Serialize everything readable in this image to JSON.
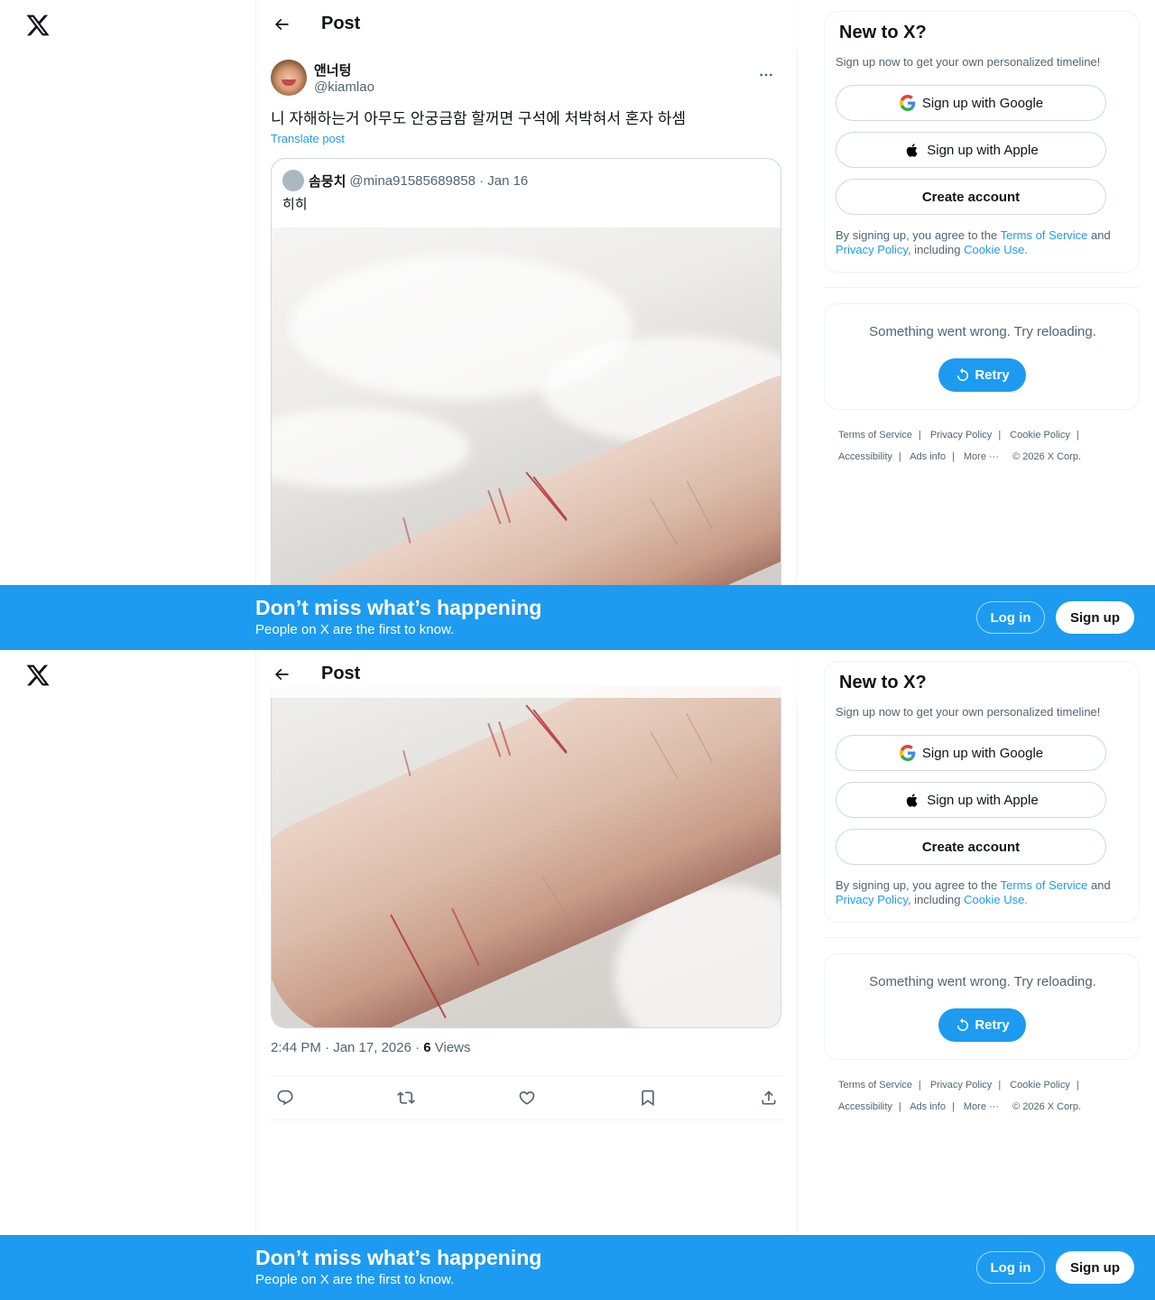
{
  "nav": {
    "logo_icon": "x-logo-icon"
  },
  "header": {
    "title": "Post",
    "back_icon": "arrow-left-icon"
  },
  "post": {
    "display_name": "앤너텅",
    "handle": "@kiamlao",
    "text": "니 자해하는거 아무도 안궁금함 할꺼면 구석에 처박혀서 혼자 하셈",
    "translate_label": "Translate post",
    "quote": {
      "name": "솜뭉치",
      "meta": "@mina91585689858 · Jan 16",
      "text": "히히"
    },
    "time": "2:44 PM · Jan 17, 2026 · ",
    "views_count": "6",
    "views_label": " Views",
    "actions": [
      "reply-icon",
      "repost-icon",
      "like-icon",
      "bookmark-icon",
      "share-icon"
    ]
  },
  "sidebar": {
    "signup": {
      "title": "New to X?",
      "subtitle": "Sign up now to get your own personalized timeline!",
      "google_label": "Sign up with Google",
      "apple_label": "Sign up with Apple",
      "create_label": "Create account",
      "legal_prefix": "By signing up, you agree to the ",
      "tos": "Terms of Service",
      "and": " and ",
      "privacy": "Privacy Policy",
      "including": ", including ",
      "cookie": "Cookie Use."
    },
    "error": {
      "text": "Something went wrong. Try reloading.",
      "retry_label": "Retry"
    },
    "footer": {
      "links": [
        "Terms of Service",
        "Privacy Policy",
        "Cookie Policy",
        "Accessibility",
        "Ads info",
        "More ···"
      ],
      "copyright": "© 2026 X Corp."
    }
  },
  "banner": {
    "title": "Don’t miss what’s happening",
    "subtitle": "People on X are the first to know.",
    "login_label": "Log in",
    "signup_label": "Sign up"
  },
  "colors": {
    "accent": "#1d9bf0",
    "text": "#0f1419",
    "muted": "#536471"
  }
}
